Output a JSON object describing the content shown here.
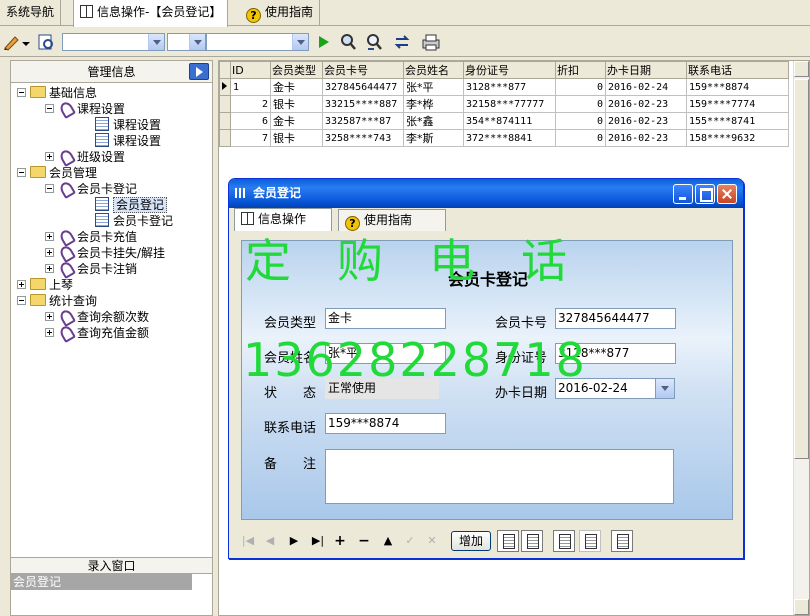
{
  "tabs": [
    {
      "label": "系统导航"
    },
    {
      "label": "信息操作-【会员登记】"
    },
    {
      "label": "使用指南"
    }
  ],
  "left_panel": {
    "header": "管理信息",
    "tree": [
      {
        "label": "基础信息"
      },
      {
        "label": "课程设置"
      },
      {
        "label": "课程设置"
      },
      {
        "label": "课程设置"
      },
      {
        "label": "班级设置"
      },
      {
        "label": "会员管理"
      },
      {
        "label": "会员卡登记"
      },
      {
        "label": "会员登记"
      },
      {
        "label": "会员卡登记"
      },
      {
        "label": "会员卡充值"
      },
      {
        "label": "会员卡挂失/解挂"
      },
      {
        "label": "会员卡注销"
      },
      {
        "label": "上琴"
      },
      {
        "label": "统计查询"
      },
      {
        "label": "查询余额次数"
      },
      {
        "label": "查询充值金额"
      }
    ],
    "footer_header": "录入窗口",
    "footer_item": "会员登记"
  },
  "grid": {
    "columns": [
      "ID",
      "会员类型",
      "会员卡号",
      "会员姓名",
      "身份证号",
      "折扣",
      "办卡日期",
      "联系电话"
    ],
    "rows": [
      [
        "1",
        "金卡",
        "327845644477",
        "张*平",
        "3128***877",
        "0",
        "2016-02-24",
        "159***8874"
      ],
      [
        "2",
        "银卡",
        "33215****887",
        "李*桦",
        "32158***77777",
        "0",
        "2016-02-23",
        "159****7774"
      ],
      [
        "6",
        "金卡",
        "332587***87",
        "张*鑫",
        "354**874111",
        "0",
        "2016-02-23",
        "155****8741"
      ],
      [
        "7",
        "银卡",
        "3258****743",
        "李*斯",
        "372****8841",
        "0",
        "2016-02-23",
        "158****9632"
      ]
    ]
  },
  "dialog": {
    "title": "会员登记",
    "tab1": "信息操作",
    "tab2": "使用指南",
    "form_title": "会员卡登记",
    "labels": {
      "card_type": "会员类型",
      "card_no": "会员卡号",
      "name": "会员姓名",
      "id_no": "身份证号",
      "status": "状　　态",
      "date": "办卡日期",
      "phone": "联系电话",
      "remark": "备　　注"
    },
    "values": {
      "card_type": "金卡",
      "card_no": "327845644477",
      "name": "张*平",
      "id_no": "3128***877",
      "status": "正常使用",
      "date": "2016-02-24",
      "phone": "159***8874",
      "remark": ""
    },
    "watermark_line1": "定　购　电　话",
    "watermark_line2": "13628228718",
    "add_button": "增加"
  },
  "icons": {
    "play": "play-icon",
    "search": "search-icon",
    "print": "printer-icon"
  }
}
